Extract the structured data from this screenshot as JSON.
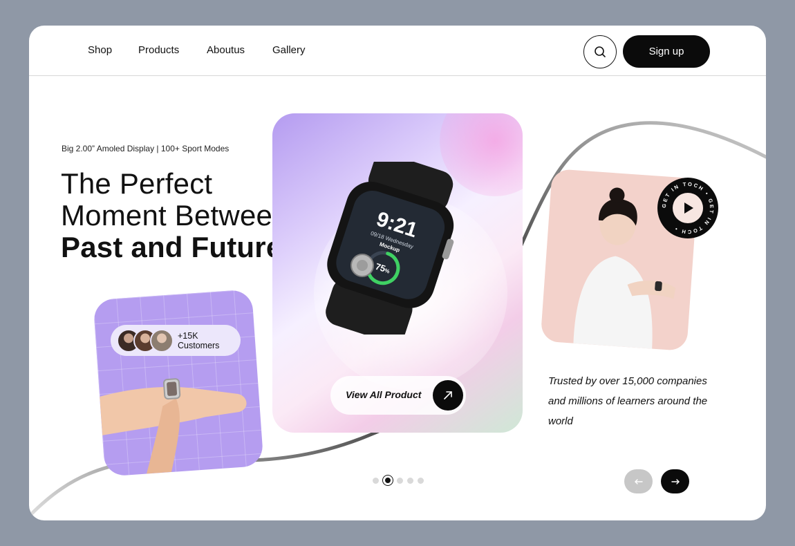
{
  "nav": {
    "links": [
      "Shop",
      "Products",
      "Aboutus",
      "Gallery"
    ],
    "search_icon": "search-icon",
    "signup_label": "Sign up"
  },
  "hero": {
    "eyebrow": "Big 2.00” Amoled Display | 100+ Sport Modes",
    "title_line1": "The Perfect",
    "title_line2": "Moment Between",
    "title_line3": "Past and Future"
  },
  "customers": {
    "label": "+15K Customers"
  },
  "watch": {
    "time": "9:21",
    "date": "09/18 Wednesday",
    "label": "Mockup",
    "progress_text": "75",
    "progress_unit": "%",
    "progress_value": 0.75
  },
  "product": {
    "cta_label": "View All Product",
    "cta_icon": "arrow-up-right-icon"
  },
  "badge": {
    "ring_text": "GET IN TOCH • GET IN TOCH •",
    "icon": "play-icon"
  },
  "trusted": {
    "text": "Trusted by over 15,000 companies and millions of learners around the world"
  },
  "carousel": {
    "active_index": 1,
    "count": 5
  },
  "pager": {
    "prev_icon": "arrow-left-icon",
    "next_icon": "arrow-right-icon"
  },
  "colors": {
    "page_bg": "#8f98a6",
    "accent_dark": "#0b0b0b",
    "purple_card": "#b59df0",
    "pink_card": "#f3d2cb"
  }
}
